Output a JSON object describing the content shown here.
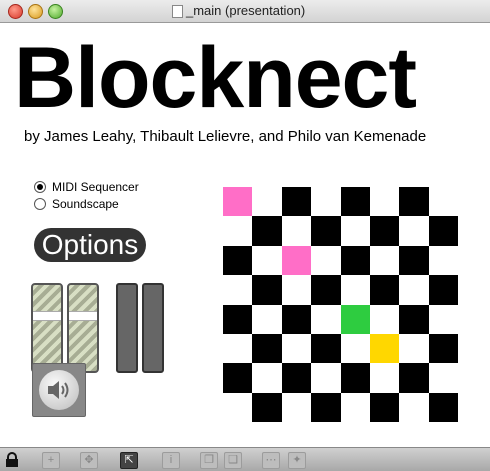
{
  "window": {
    "title": "_main (presentation)"
  },
  "app": {
    "title": "Blocknect",
    "authors": "by James Leahy, Thibault Lelievre, and Philo van Kemenade"
  },
  "modes": [
    {
      "label": "MIDI Sequencer",
      "selected": true
    },
    {
      "label": "Soundscape",
      "selected": false
    }
  ],
  "options_label": "Options",
  "grid": {
    "rows": 8,
    "cols": 8,
    "base_pattern": "checkerboard",
    "black_color": "#000000",
    "white_color": "#ffffff",
    "highlights": [
      {
        "row": 0,
        "col": 0,
        "color": "#ff6ec7"
      },
      {
        "row": 2,
        "col": 2,
        "color": "#ff6ec7"
      },
      {
        "row": 4,
        "col": 4,
        "color": "#2ecc40"
      },
      {
        "row": 5,
        "col": 5,
        "color": "#ffd700"
      }
    ]
  },
  "toolbar_icons": [
    "lock-icon",
    "plus-icon",
    "move-icon",
    "presentation-icon",
    "info-icon",
    "layers-icon",
    "stack-icon",
    "grid-icon",
    "settings-icon"
  ]
}
